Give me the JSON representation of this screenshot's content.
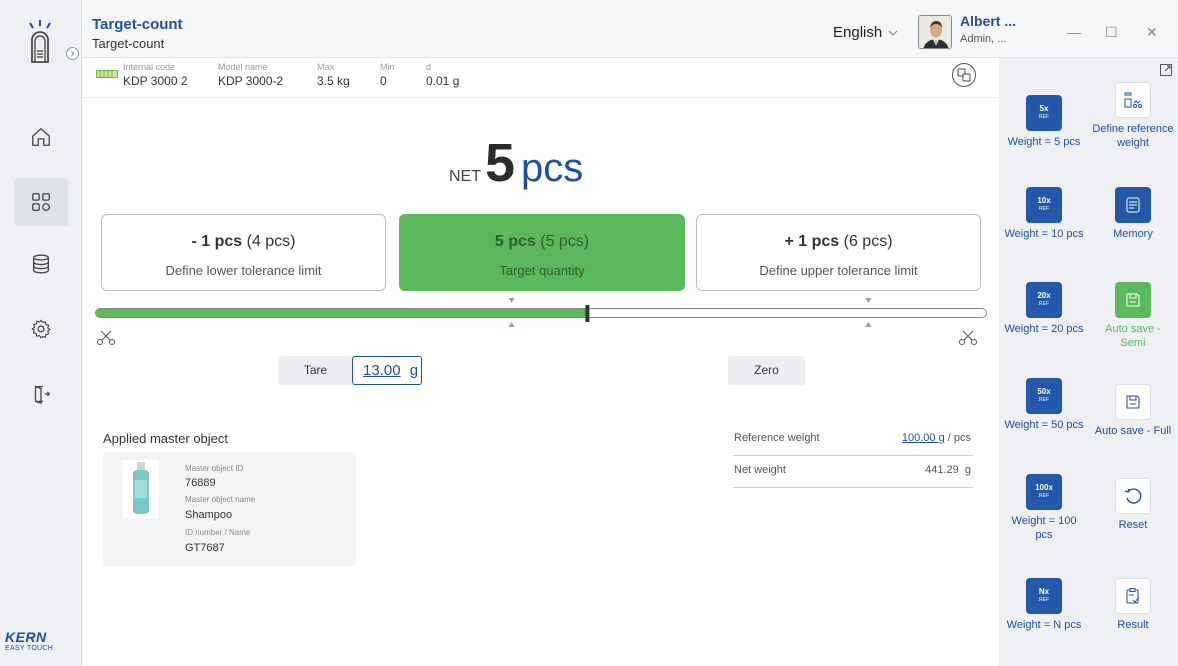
{
  "header": {
    "title": "Target-count",
    "subtitle": "Target-count",
    "language": "English",
    "user_name": "Albert ...",
    "user_role": "Admin, ...",
    "window_controls": {
      "minimize": "—",
      "maximize": "☐",
      "close": "✕"
    }
  },
  "device_info": {
    "internal_code_label": "Internal code",
    "internal_code": "KDP 3000 2",
    "model_name_label": "Model name",
    "model_name": "KDP 3000-2",
    "max_label": "Max",
    "max": "3.5 kg",
    "min_label": "Min",
    "min": "0",
    "d_label": "d",
    "d": "0.01 g"
  },
  "readout": {
    "net_label": "NET",
    "value": "5",
    "unit": "pcs"
  },
  "tolerance": {
    "lower": {
      "delta": "- 1 pcs",
      "abs": "(4 pcs)",
      "label": "Define lower tolerance limit"
    },
    "target": {
      "delta": "5 pcs",
      "abs": "(5 pcs)",
      "label": "Target quantity"
    },
    "upper": {
      "delta": "+ 1 pcs",
      "abs": "(6 pcs)",
      "label": "Define upper tolerance limit"
    }
  },
  "bar": {
    "fill_fraction": 0.55,
    "lower_fraction": 0.467,
    "target_fraction": 0.552,
    "upper_fraction": 0.867
  },
  "tare": {
    "label": "Tare",
    "value": "13.00",
    "unit": "g"
  },
  "zero": {
    "label": "Zero"
  },
  "master_object": {
    "title": "Applied master object",
    "id_label": "Master object ID",
    "id": "76889",
    "name_label": "Master object name",
    "name": "Shampoo",
    "idnum_label": "ID number / Name",
    "idnum": "GT7687"
  },
  "weights": {
    "reference_label": "Reference weight",
    "reference_value": "100.00 g",
    "reference_unit": "/ pcs",
    "net_label": "Net weight",
    "net_value": "441.29",
    "net_unit": "g"
  },
  "right_panel": {
    "ref5": {
      "icon_top": "5x",
      "icon_sub": "REF",
      "label": "Weight = 5 pcs"
    },
    "ref10": {
      "icon_top": "10x",
      "icon_sub": "REF",
      "label": "Weight = 10 pcs"
    },
    "ref20": {
      "icon_top": "20x",
      "icon_sub": "REF",
      "label": "Weight = 20 pcs"
    },
    "ref50": {
      "icon_top": "50x",
      "icon_sub": "REF",
      "label": "Weight = 50 pcs"
    },
    "ref100": {
      "icon_top": "100x",
      "icon_sub": "REF",
      "label": "Weight = 100 pcs"
    },
    "refN": {
      "icon_top": "Nx",
      "icon_sub": "REF",
      "label": "Weight = N pcs"
    },
    "define_ref": {
      "label": "Define reference weight"
    },
    "memory": {
      "label": "Memory"
    },
    "auto_semi": {
      "label": "Auto save - Semi"
    },
    "auto_full": {
      "label": "Auto save - Full"
    },
    "reset": {
      "label": "Reset"
    },
    "result": {
      "label": "Result"
    }
  },
  "brand": {
    "name": "KERN",
    "tagline": "EASY TOUCH"
  },
  "colors": {
    "accent": "#1f4fa0",
    "green": "#5cb85c",
    "ref_blue": "#2358a8"
  }
}
